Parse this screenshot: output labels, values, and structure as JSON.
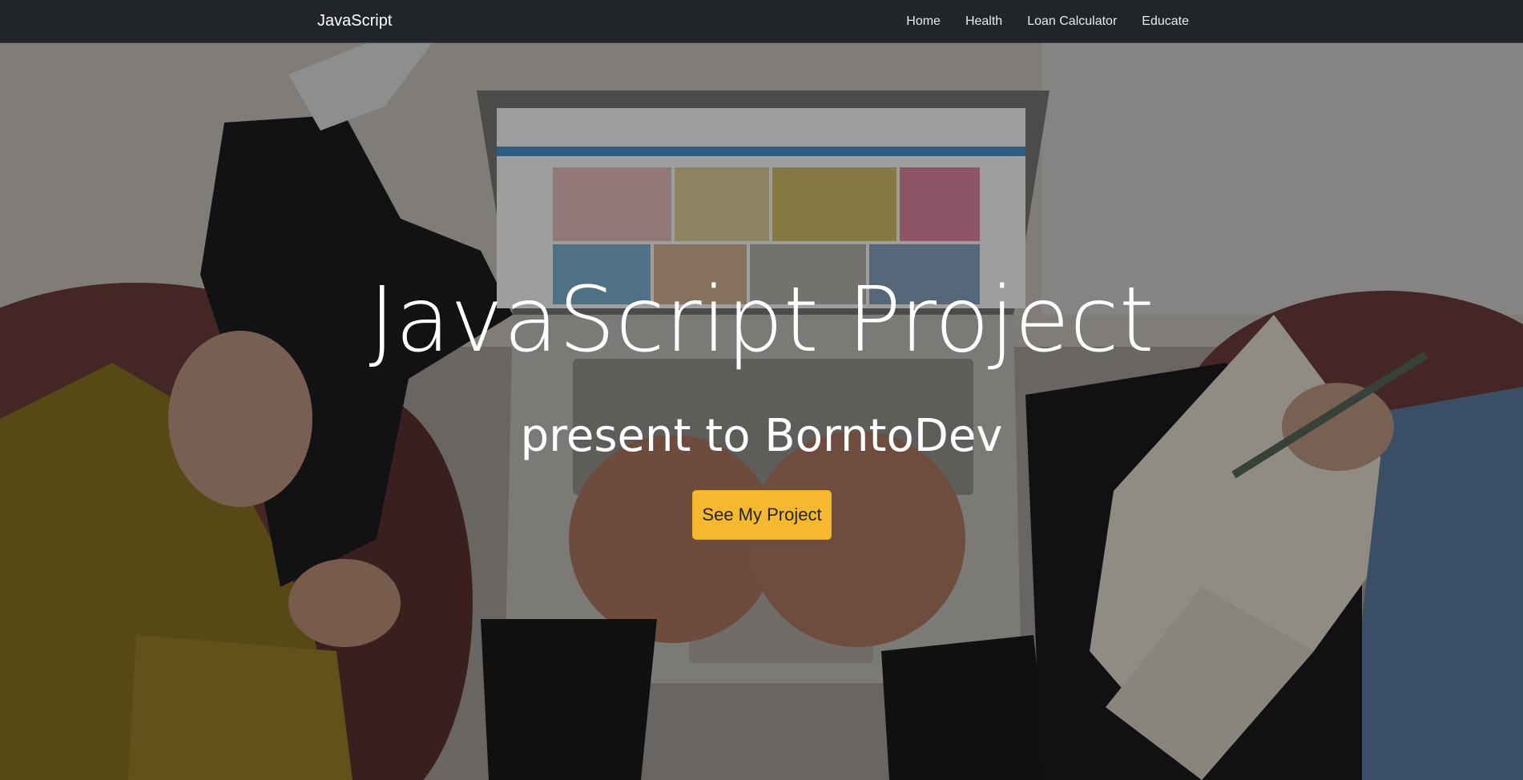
{
  "navbar": {
    "brand": "JavaScript",
    "links": [
      {
        "label": "Home"
      },
      {
        "label": "Health"
      },
      {
        "label": "Loan Calculator"
      },
      {
        "label": "Educate"
      }
    ]
  },
  "hero": {
    "title": "JavaScript Project",
    "subtitle": "present to BorntoDev",
    "cta_label": "See My Project",
    "background_image": "people-working-with-laptop-and-notebook-photo"
  },
  "colors": {
    "navbar_bg": "#212529",
    "cta_bg": "#f5b82e",
    "text_light": "#ffffff"
  }
}
